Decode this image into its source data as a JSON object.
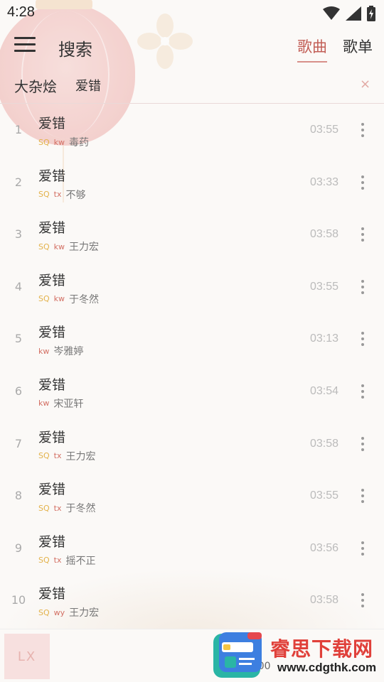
{
  "status_bar": {
    "time": "4:28"
  },
  "header": {
    "title": "搜索",
    "tabs": [
      {
        "label": "歌曲",
        "active": true
      },
      {
        "label": "歌单",
        "active": false
      }
    ]
  },
  "search": {
    "source": "大杂烩",
    "query": "爱错",
    "clear_icon": "×"
  },
  "songs": [
    {
      "index": "1",
      "title": "爱错",
      "sq": "SQ",
      "src": "kw",
      "artist": "毒药",
      "duration": "03:55"
    },
    {
      "index": "2",
      "title": "爱错",
      "sq": "SQ",
      "src": "tx",
      "artist": "不够",
      "duration": "03:33"
    },
    {
      "index": "3",
      "title": "爱错",
      "sq": "SQ",
      "src": "kw",
      "artist": "王力宏",
      "duration": "03:58"
    },
    {
      "index": "4",
      "title": "爱错",
      "sq": "SQ",
      "src": "kw",
      "artist": "于冬然",
      "duration": "03:55"
    },
    {
      "index": "5",
      "title": "爱错",
      "sq": "",
      "src": "kw",
      "artist": "岑雅婷",
      "duration": "03:13"
    },
    {
      "index": "6",
      "title": "爱错",
      "sq": "",
      "src": "kw",
      "artist": "宋亚轩",
      "duration": "03:54"
    },
    {
      "index": "7",
      "title": "爱错",
      "sq": "SQ",
      "src": "tx",
      "artist": "王力宏",
      "duration": "03:58"
    },
    {
      "index": "8",
      "title": "爱错",
      "sq": "SQ",
      "src": "tx",
      "artist": "于冬然",
      "duration": "03:55"
    },
    {
      "index": "9",
      "title": "爱错",
      "sq": "SQ",
      "src": "tx",
      "artist": "摇不正",
      "duration": "03:56"
    },
    {
      "index": "10",
      "title": "爱错",
      "sq": "SQ",
      "src": "wy",
      "artist": "王力宏",
      "duration": "03:58"
    }
  ],
  "player": {
    "cover_text": "LX",
    "time": ":00"
  },
  "watermark": {
    "name": "睿思下载网",
    "url": "www.cdgthk.com"
  },
  "colors": {
    "accent": "#c25e56",
    "sq": "#e3b24a",
    "source_tag": "#d36f63"
  }
}
